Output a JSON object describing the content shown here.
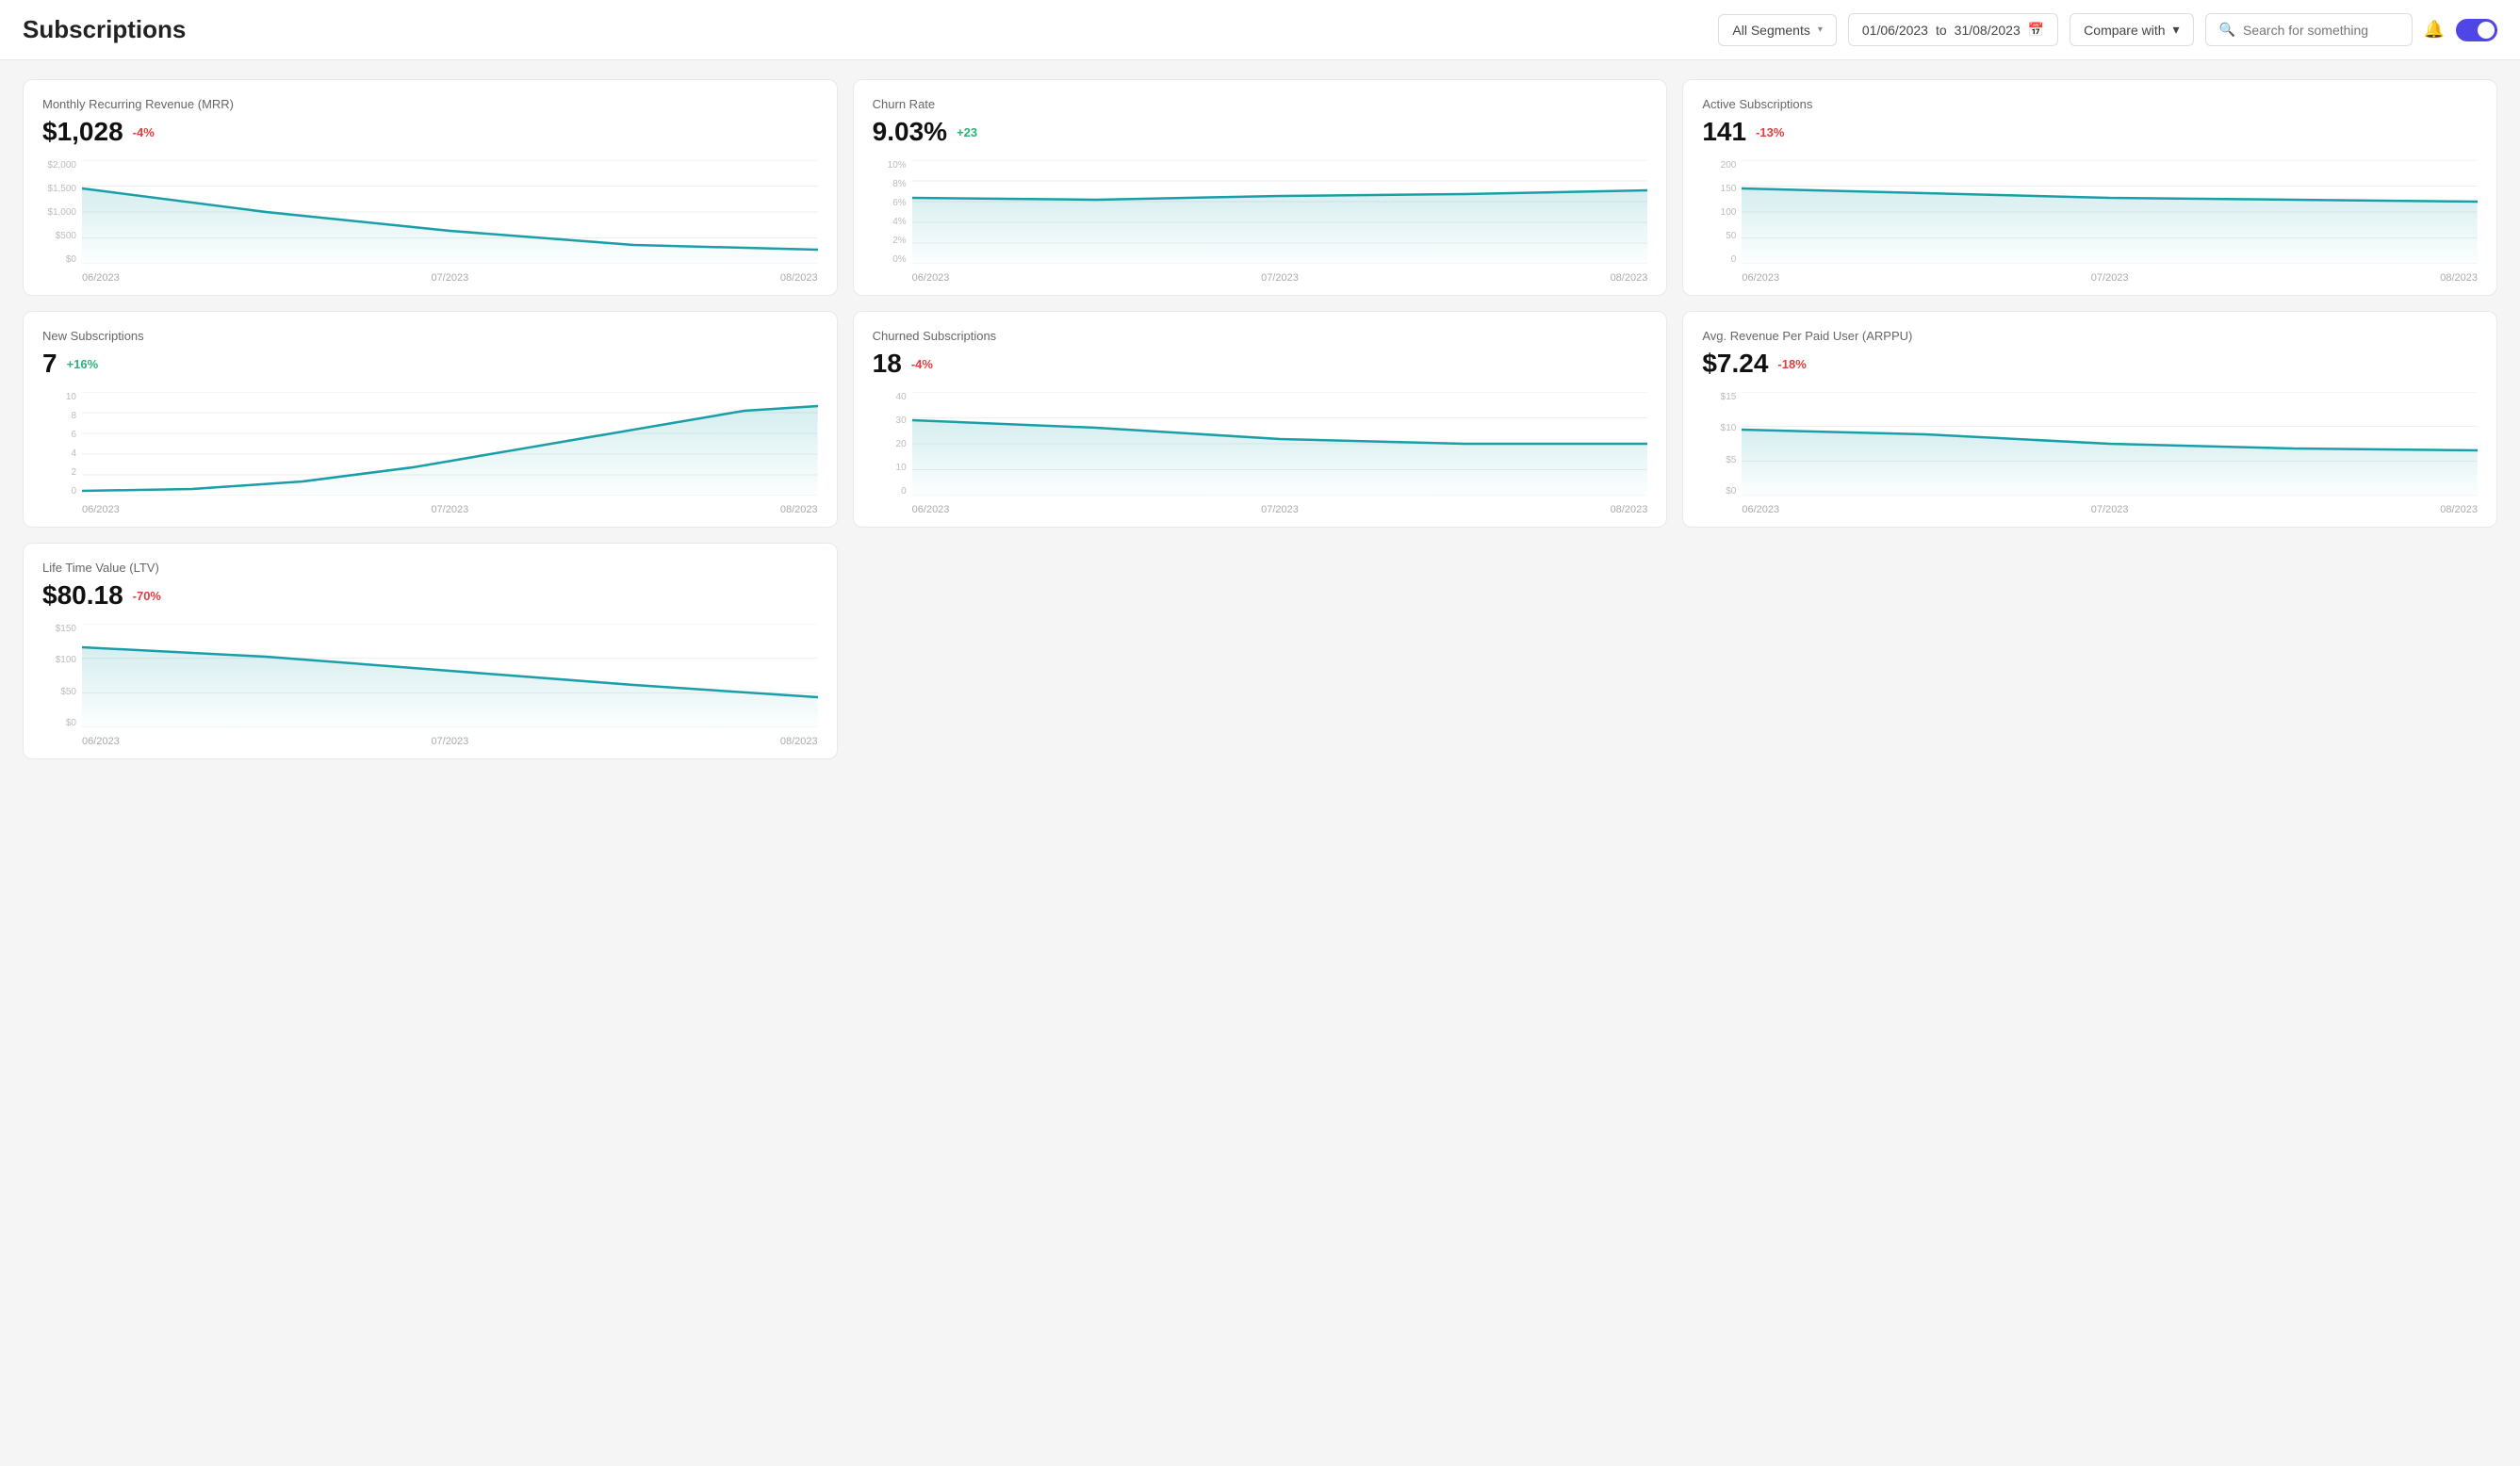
{
  "header": {
    "title": "Subscriptions",
    "segment_label": "All Segments",
    "date_from": "01/06/2023",
    "date_to": "31/08/2023",
    "compare_label": "Compare with",
    "search_placeholder": "Search for something"
  },
  "cards": [
    {
      "id": "mrr",
      "title": "Monthly Recurring Revenue (MRR)",
      "value": "$1,028",
      "badge": "-4%",
      "badge_type": "negative",
      "y_labels": [
        "$2,000",
        "$1,500",
        "$1,000",
        "$500",
        "$0"
      ],
      "x_labels": [
        "06/2023",
        "07/2023",
        "08/2023"
      ],
      "line_points": "0,30 100,55 200,75 300,90 400,95"
    },
    {
      "id": "churn",
      "title": "Churn Rate",
      "value": "9.03%",
      "badge": "+23",
      "badge_type": "positive",
      "y_labels": [
        "10%",
        "8%",
        "6%",
        "4%",
        "2%",
        "0%"
      ],
      "x_labels": [
        "06/2023",
        "07/2023",
        "08/2023"
      ],
      "line_points": "0,40 100,42 200,38 300,36 400,32"
    },
    {
      "id": "active",
      "title": "Active Subscriptions",
      "value": "141",
      "badge": "-13%",
      "badge_type": "negative",
      "y_labels": [
        "200",
        "150",
        "100",
        "50",
        "0"
      ],
      "x_labels": [
        "06/2023",
        "07/2023",
        "08/2023"
      ],
      "line_points": "0,30 100,35 200,40 300,42 400,44"
    },
    {
      "id": "new_subs",
      "title": "New Subscriptions",
      "value": "7",
      "badge": "+16%",
      "badge_type": "positive",
      "y_labels": [
        "10",
        "8",
        "6",
        "4",
        "2",
        "0"
      ],
      "x_labels": [
        "06/2023",
        "07/2023",
        "08/2023"
      ],
      "line_points": "0,105 60,103 120,95 180,80 240,60 300,40 360,20 400,15"
    },
    {
      "id": "churned",
      "title": "Churned Subscriptions",
      "value": "18",
      "badge": "-4%",
      "badge_type": "negative",
      "y_labels": [
        "40",
        "30",
        "20",
        "10",
        "0"
      ],
      "x_labels": [
        "06/2023",
        "07/2023",
        "08/2023"
      ],
      "line_points": "0,30 100,38 200,50 300,55 400,55"
    },
    {
      "id": "arppu",
      "title": "Avg. Revenue Per Paid User (ARPPU)",
      "value": "$7.24",
      "badge": "-18%",
      "badge_type": "negative",
      "y_labels": [
        "$15",
        "$10",
        "$5",
        "$0"
      ],
      "x_labels": [
        "06/2023",
        "07/2023",
        "08/2023"
      ],
      "line_points": "0,40 100,45 200,55 300,60 400,62"
    },
    {
      "id": "ltv",
      "title": "Life Time Value (LTV)",
      "value": "$80.18",
      "badge": "-70%",
      "badge_type": "negative",
      "y_labels": [
        "$150",
        "$100",
        "$50",
        "$0"
      ],
      "x_labels": [
        "06/2023",
        "07/2023",
        "08/2023"
      ],
      "line_points": "0,25 100,35 200,50 300,65 400,78"
    }
  ]
}
